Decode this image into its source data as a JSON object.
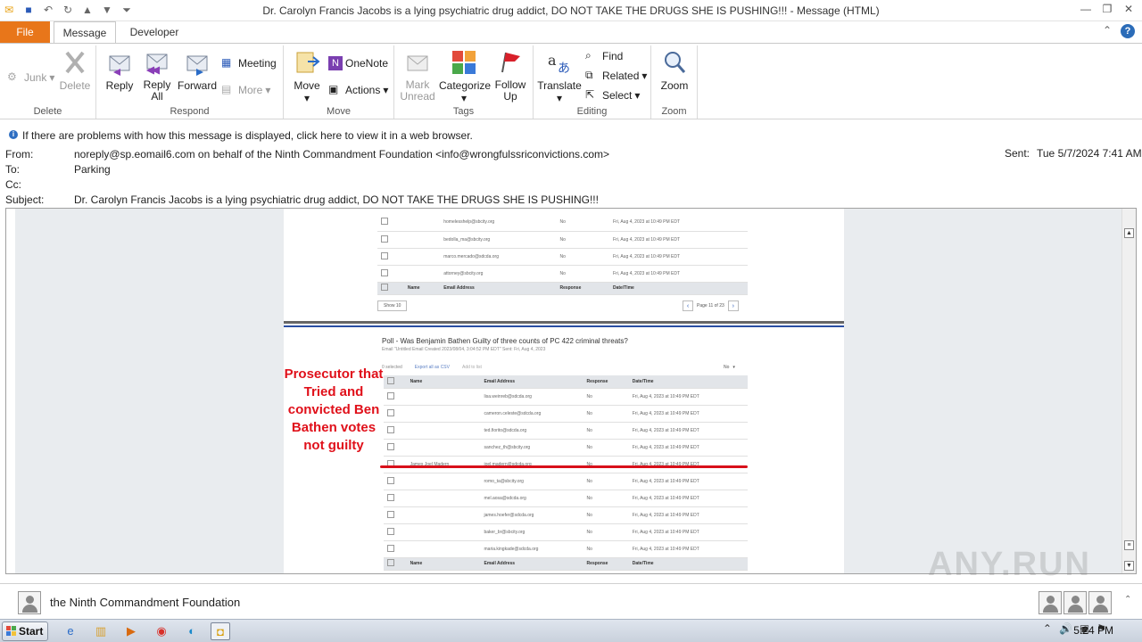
{
  "window": {
    "title": "Dr. Carolyn Francis Jacobs is a lying psychiatric drug addict, DO NOT TAKE THE DRUGS SHE IS PUSHING!!!  -  Message (HTML)"
  },
  "tabs": {
    "file": "File",
    "message": "Message",
    "developer": "Developer"
  },
  "ribbon": {
    "delete_group": {
      "label": "Delete",
      "junk": "Junk",
      "delete": "Delete"
    },
    "respond_group": {
      "label": "Respond",
      "reply": "Reply",
      "reply_all": "Reply All",
      "forward": "Forward",
      "meeting": "Meeting",
      "more": "More"
    },
    "move_group": {
      "label": "Move",
      "move": "Move",
      "onenote": "OneNote",
      "actions": "Actions"
    },
    "tags_group": {
      "label": "Tags",
      "mark_unread": "Mark Unread",
      "categorize": "Categorize",
      "follow_up": "Follow Up"
    },
    "editing_group": {
      "label": "Editing",
      "translate": "Translate",
      "find": "Find",
      "related": "Related",
      "select": "Select"
    },
    "zoom_group": {
      "label": "Zoom",
      "zoom": "Zoom"
    }
  },
  "infobar": {
    "message": "If there are problems with how this message is displayed, click here to view it in a web browser."
  },
  "header": {
    "from_label": "From:",
    "from_value": "noreply@sp.eomail6.com on behalf of the Ninth Commandment Foundation <info@wrongfulssriconvictions.com>",
    "to_label": "To:",
    "to_value": "Parking",
    "cc_label": "Cc:",
    "cc_value": "",
    "subject_label": "Subject:",
    "subject_value": "Dr. Carolyn Francis Jacobs is a lying psychiatric drug addict, DO NOT TAKE THE DRUGS SHE IS PUSHING!!!",
    "sent_label": "Sent:",
    "sent_value": "Tue 5/7/2024 7:41 AM"
  },
  "body": {
    "top_table": {
      "rows": [
        {
          "email": "homelesshelp@sbcity.org",
          "response": "No",
          "datetime": "Fri, Aug 4, 2023 at 10:49 PM EDT"
        },
        {
          "email": "bedolla_ma@sbcity.org",
          "response": "No",
          "datetime": "Fri, Aug 4, 2023 at 10:49 PM EDT"
        },
        {
          "email": "marco.mercado@sdcda.org",
          "response": "No",
          "datetime": "Fri, Aug 4, 2023 at 10:49 PM EDT"
        },
        {
          "email": "attorney@sbcity.org",
          "response": "No",
          "datetime": "Fri, Aug 4, 2023 at 10:49 PM EDT"
        }
      ],
      "headers": {
        "name": "Name",
        "email": "Email Address",
        "response": "Response",
        "datetime": "Date/Time"
      },
      "show": "Show 10",
      "page": "Page 11 of 23"
    },
    "poll": {
      "title": "Poll - Was Benjamin Bathen Guilty of three counts of PC 422 criminal threats?",
      "subtitle": "Email \"Untitled Email Created 2023/08/04, 3:04:52 PM EDT\"  Sent: Fri, Aug 4, 2023",
      "selected": "0 selected",
      "export": "Export all as CSV",
      "add_to_list": "Add to list",
      "filter": "No",
      "headers": {
        "name": "Name",
        "email": "Email Address",
        "response": "Response",
        "datetime": "Date/Time"
      },
      "rows": [
        {
          "name": "",
          "email": "lisa.weinreb@sdcda.org",
          "response": "No",
          "datetime": "Fri, Aug 4, 2023 at 10:49 PM EDT"
        },
        {
          "name": "",
          "email": "cameron.celeste@sdcda.org",
          "response": "No",
          "datetime": "Fri, Aug 4, 2023 at 10:49 PM EDT"
        },
        {
          "name": "",
          "email": "ted.fiorito@sdcda.org",
          "response": "No",
          "datetime": "Fri, Aug 4, 2023 at 10:49 PM EDT"
        },
        {
          "name": "",
          "email": "sanchez_th@sbcity.org",
          "response": "No",
          "datetime": "Fri, Aug 4, 2023 at 10:49 PM EDT"
        },
        {
          "name": "James Joel Madern",
          "email": "joel.madern@sdcda.org",
          "response": "No",
          "datetime": "Fri, Aug 4, 2023 at 10:49 PM EDT"
        },
        {
          "name": "",
          "email": "romo_ta@sbcity.org",
          "response": "No",
          "datetime": "Fri, Aug 4, 2023 at 10:49 PM EDT"
        },
        {
          "name": "",
          "email": "mel.aosa@sdcda.org",
          "response": "No",
          "datetime": "Fri, Aug 4, 2023 at 10:49 PM EDT"
        },
        {
          "name": "",
          "email": "james.hoefer@sdcda.org",
          "response": "No",
          "datetime": "Fri, Aug 4, 2023 at 10:49 PM EDT"
        },
        {
          "name": "",
          "email": "baker_br@sbcity.org",
          "response": "No",
          "datetime": "Fri, Aug 4, 2023 at 10:49 PM EDT"
        },
        {
          "name": "",
          "email": "maria.kingkade@sdcda.org",
          "response": "No",
          "datetime": "Fri, Aug 4, 2023 at 10:49 PM EDT"
        }
      ]
    },
    "annotation": "Prosecutor that Tried and convicted Ben Bathen votes not guilty"
  },
  "people_pane": {
    "name": "the Ninth Commandment Foundation"
  },
  "taskbar": {
    "start": "Start",
    "clock": "5:24 PM"
  },
  "watermark": "ANY.RUN",
  "colors": {
    "file_tab": "#e8761a",
    "annotation_red": "#e0101a",
    "poll_divider": "#2a4ea3"
  }
}
